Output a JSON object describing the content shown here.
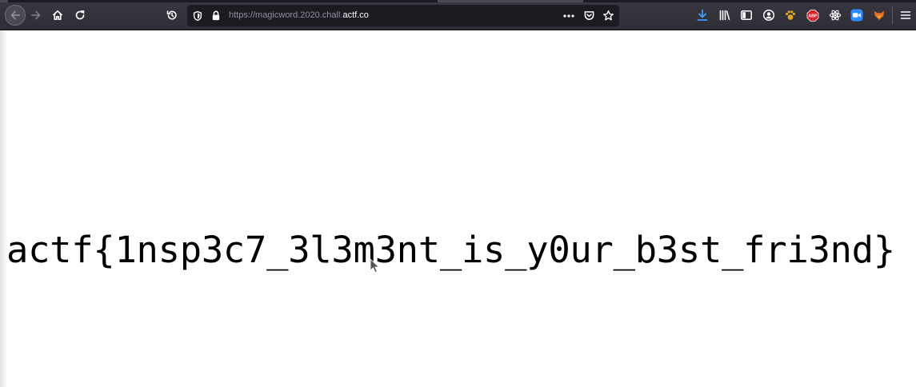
{
  "browser": {
    "url_scheme": "https://",
    "url_host_prefix": "magicword.2020.chall.",
    "url_host_domain": "actf.co",
    "icons": {
      "back": "back-arrow-icon",
      "forward": "forward-arrow-icon",
      "home": "home-icon",
      "reload": "reload-icon",
      "history": "history-icon",
      "tracking": "shield-icon",
      "lock": "lock-icon",
      "page_actions": "more-dots-icon",
      "pocket": "pocket-icon",
      "bookmark": "bookmark-star-icon",
      "downloads": "download-icon",
      "library": "library-icon",
      "sidebar": "sidebar-icon",
      "account": "account-icon",
      "extensions": [
        "paw-extension-icon",
        "abp-adblock-icon",
        "react-devtools-icon",
        "zoom-extension-icon",
        "fox-extension-icon"
      ],
      "menu": "hamburger-menu-icon"
    },
    "abp_label": "ABP"
  },
  "page": {
    "flag_text": "actf{1nsp3c7_3l3m3nt_is_y0ur_b3st_fri3nd}"
  },
  "colors": {
    "toolbar": "#2f2e36",
    "urlbar": "#1c1b22",
    "download_blue": "#3d9bff",
    "abp_red": "#d9232b",
    "zoom_blue": "#2d8cff",
    "fox_orange": "#e8711c"
  }
}
